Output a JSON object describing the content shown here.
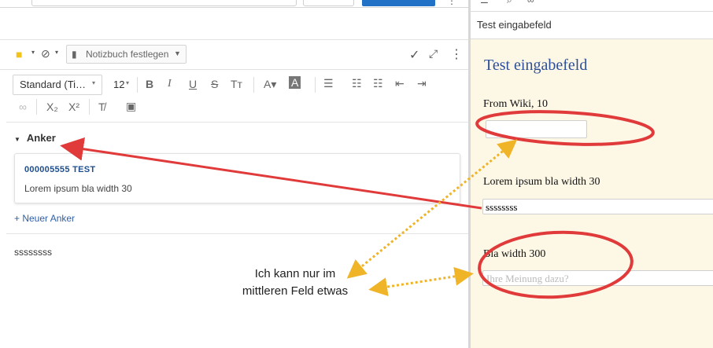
{
  "toolbar": {
    "notebook_label": "Notizbuch festlegen",
    "font_family": "Standard (Ti…",
    "font_size": "12"
  },
  "anchor_section": {
    "title": "Anker",
    "card_id": "000005555 TEST",
    "card_text": "Lorem ipsum bla width 30",
    "new_anchor": "+ Neuer Anker"
  },
  "editor": {
    "content": "ssssssss"
  },
  "annotation": {
    "line1": "Ich kann nur im",
    "line2": "mittleren Feld etwas"
  },
  "right_pane": {
    "header": "Test eingabefeld",
    "form_title": "Test eingabefeld",
    "field1_label": "From Wiki, 10",
    "field2_label": "Lorem ipsum bla width 30",
    "field2_value": "ssssssss",
    "field3_label": "Bla width 300",
    "field3_placeholder": "Ihre Meinung dazu?"
  },
  "colors": {
    "accent_blue": "#2172c7",
    "annotation_red": "#e03a3a",
    "annotation_yellow": "#f0b429",
    "form_bg": "#fdf7e6"
  }
}
